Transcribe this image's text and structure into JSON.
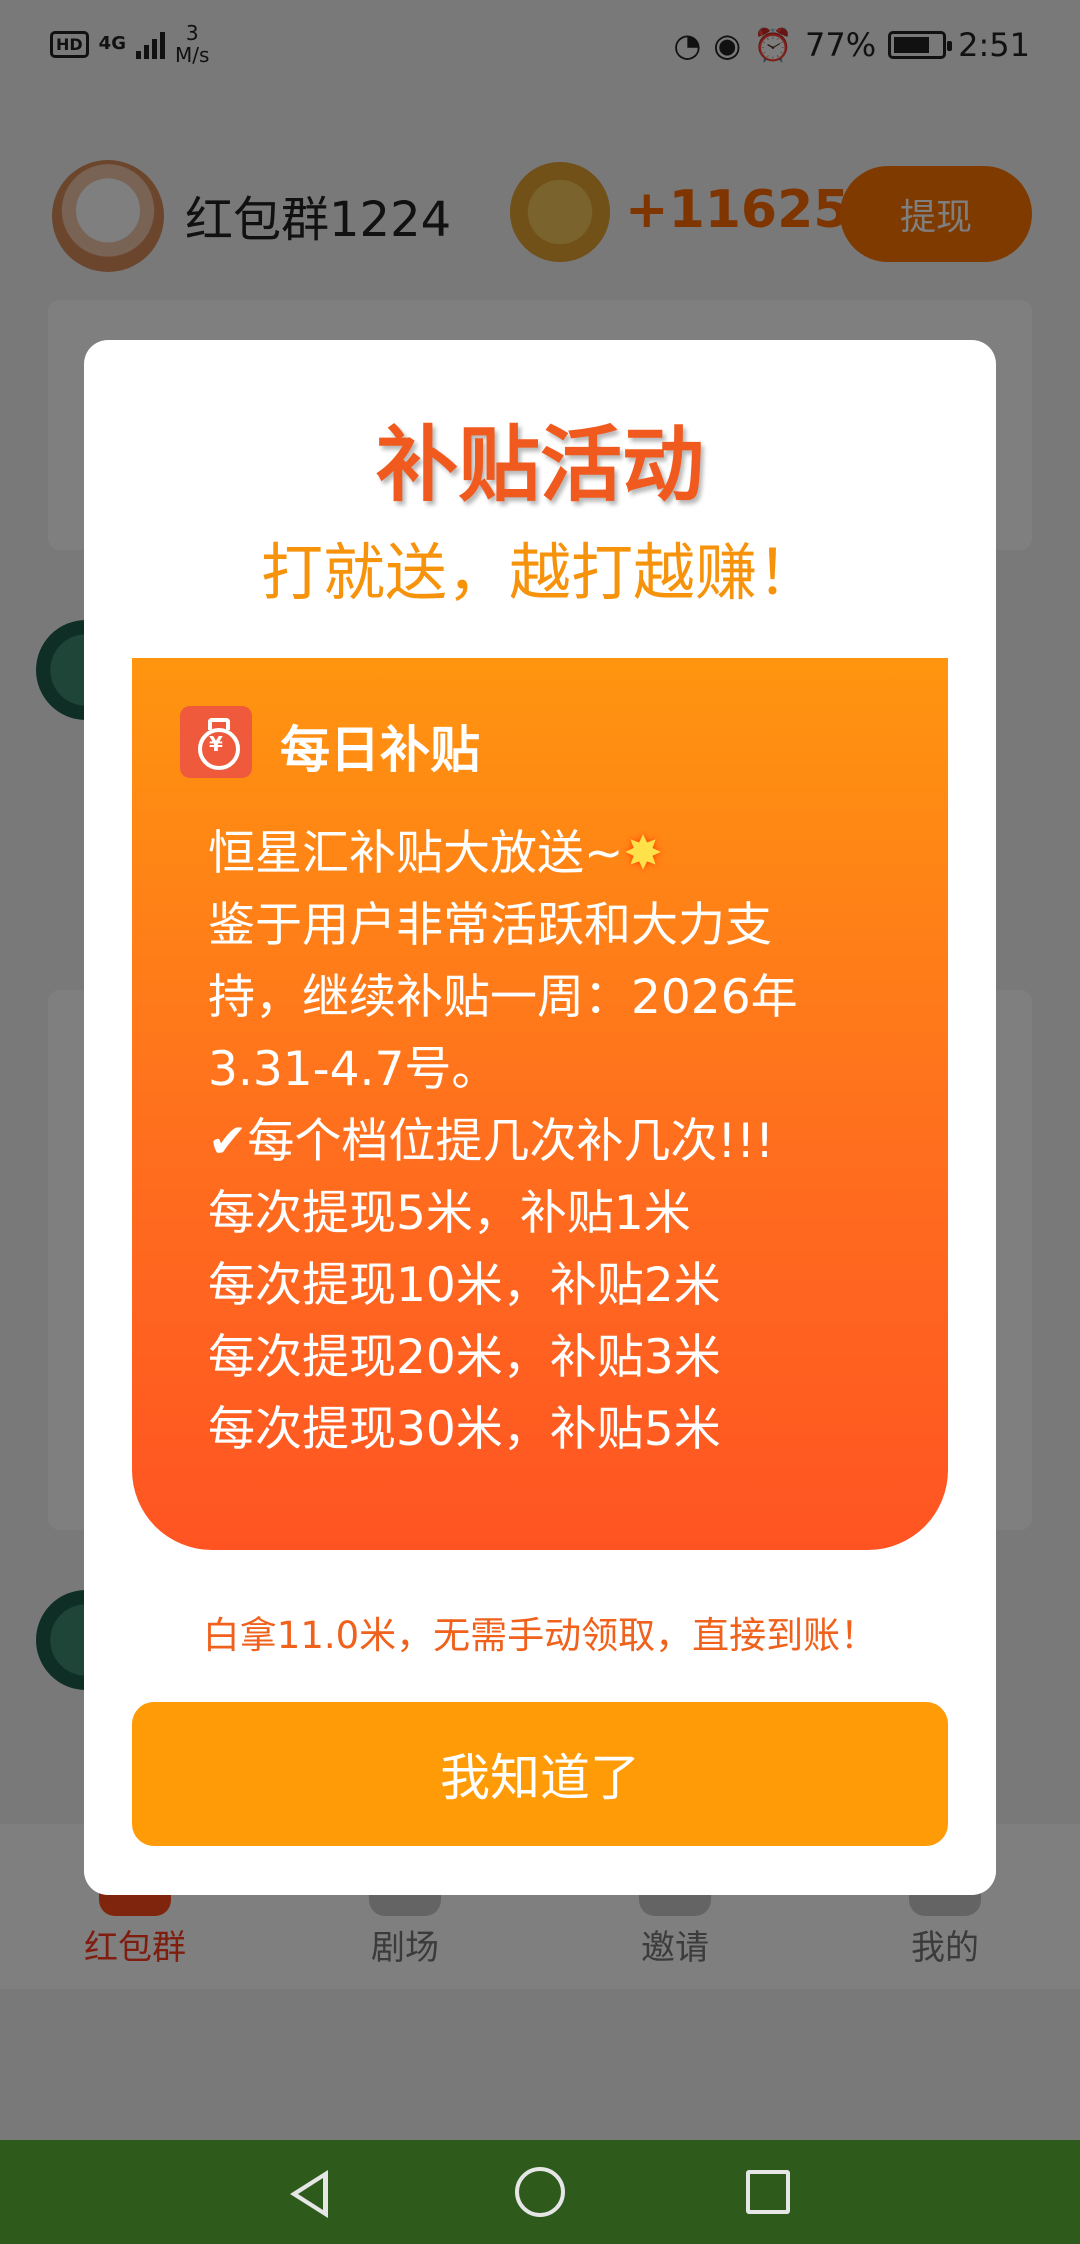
{
  "status_bar": {
    "hd": "HD",
    "network": "4G",
    "speed_value": "3",
    "speed_unit": "M/s",
    "battery": "77%",
    "time": "2:51",
    "battery_level": 0.77
  },
  "header": {
    "group_name": "红包群1224",
    "coin_amount": "+11625",
    "withdraw_label": "提现"
  },
  "bottom_nav": {
    "items": [
      {
        "label": "红包群",
        "active": true
      },
      {
        "label": "剧场",
        "active": false
      },
      {
        "label": "邀请",
        "active": false
      },
      {
        "label": "我的",
        "active": false
      }
    ]
  },
  "modal": {
    "title": "补贴活动",
    "subtitle": "打就送，越打越赚！",
    "panel": {
      "icon_symbol": "¥",
      "title": "每日补贴",
      "lines": [
        "恒星汇补贴大放送~",
        "鉴于用户非常活跃和大力支",
        "持，继续补贴一周：2026年",
        "3.31-4.7号。",
        "✔每个档位提几次补几次!!!",
        "每次提现5米，补贴1米",
        "每次提现10米，补贴2米",
        "每次提现20米，补贴3米",
        "每次提现30米，补贴5米"
      ],
      "burst_emoji": "✸"
    },
    "note": "白拿11.0米，无需手动领取，直接到账！",
    "button_label": "我知道了"
  },
  "colors": {
    "accent_orange": "#ff7500",
    "title_red": "#f05a1e",
    "button_orange": "#ff9b06",
    "nav_active": "#ff3b1f"
  }
}
